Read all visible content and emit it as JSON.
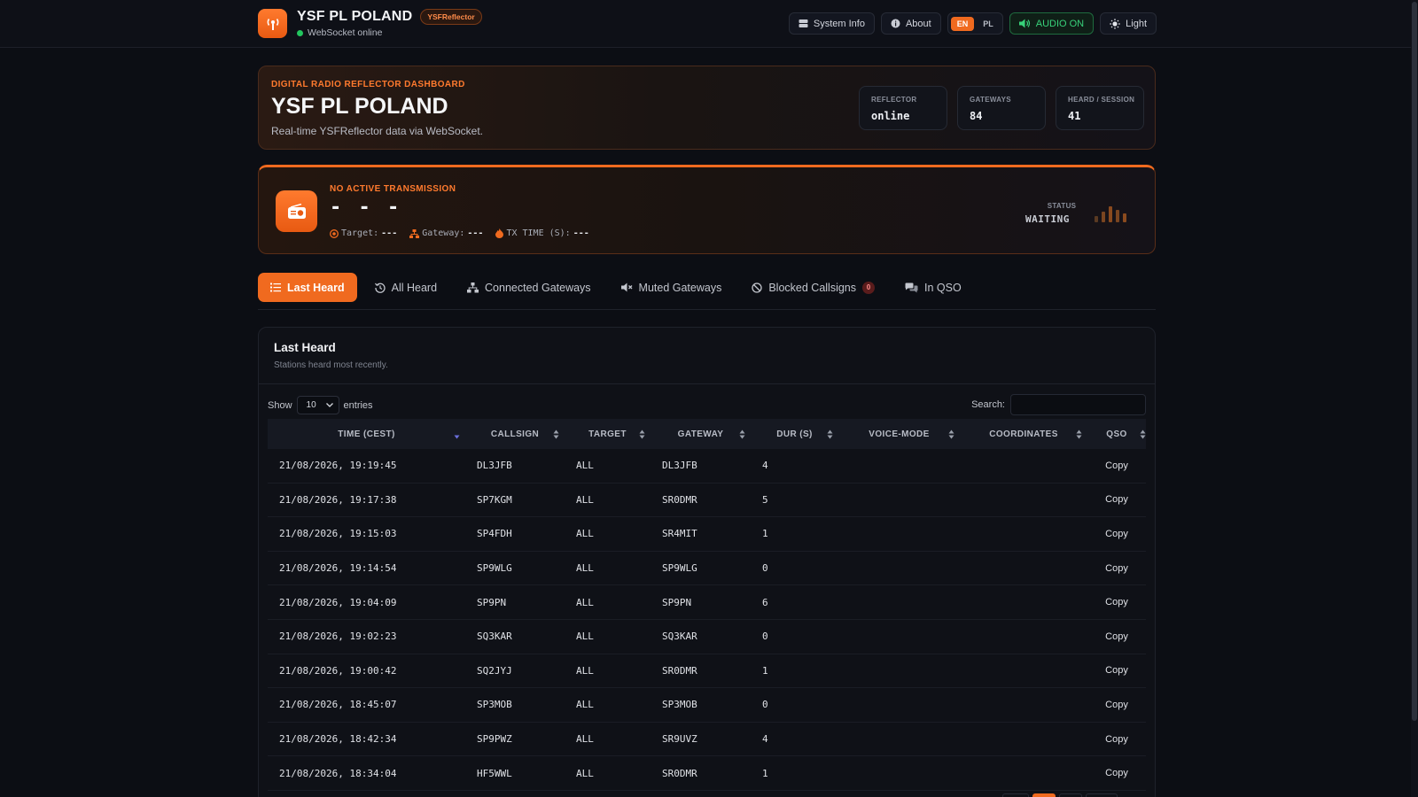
{
  "header": {
    "title": "YSF PL POLAND",
    "badge": "YSFReflector",
    "connection": "WebSocket online",
    "actions": {
      "system_info": "System Info",
      "about": "About",
      "lang_en": "EN",
      "lang_pl": "PL",
      "audio": "AUDIO ON",
      "theme": "Light"
    }
  },
  "hero": {
    "kicker": "DIGITAL RADIO REFLECTOR DASHBOARD",
    "title": "YSF PL POLAND",
    "subtitle": "Real-time YSFReflector data via WebSocket.",
    "stats": [
      {
        "label": "REFLECTOR",
        "value": "online"
      },
      {
        "label": "GATEWAYS",
        "value": "84"
      },
      {
        "label": "HEARD / SESSION",
        "value": "41"
      }
    ]
  },
  "transmission": {
    "kicker": "NO ACTIVE TRANSMISSION",
    "callsign": "- - -",
    "target_label": "Target:",
    "target_value": "---",
    "gateway_label": "Gateway:",
    "gateway_value": "---",
    "txtime_label": "TX TIME (S):",
    "txtime_value": "---",
    "status_label": "STATUS",
    "status_value": "WAITING"
  },
  "tabs": [
    {
      "label": "Last Heard",
      "icon": "list-icon",
      "active": true
    },
    {
      "label": "All Heard",
      "icon": "history-icon"
    },
    {
      "label": "Connected Gateways",
      "icon": "network-icon"
    },
    {
      "label": "Muted Gateways",
      "icon": "mute-icon"
    },
    {
      "label": "Blocked Callsigns",
      "icon": "ban-icon",
      "count": "0"
    },
    {
      "label": "In QSO",
      "icon": "chat-icon"
    }
  ],
  "table_card": {
    "title": "Last Heard",
    "subtitle": "Stations heard most recently.",
    "show_label": "Show",
    "entries_value": "10",
    "entries_label": "entries",
    "search_label": "Search:",
    "search_value": "",
    "columns": [
      "TIME (CEST)",
      "CALLSIGN",
      "TARGET",
      "GATEWAY",
      "DUR (S)",
      "VOICE-MODE",
      "COORDINATES",
      "QSO"
    ],
    "rows": [
      {
        "time": "21/08/2026, 19:19:45",
        "callsign": "DL3JFB",
        "target": "ALL",
        "gateway": "DL3JFB",
        "dur": "4",
        "mode": "",
        "coords": "",
        "qso": "Copy"
      },
      {
        "time": "21/08/2026, 19:17:38",
        "callsign": "SP7KGM",
        "target": "ALL",
        "gateway": "SR0DMR",
        "dur": "5",
        "mode": "",
        "coords": "",
        "qso": "Copy"
      },
      {
        "time": "21/08/2026, 19:15:03",
        "callsign": "SP4FDH",
        "target": "ALL",
        "gateway": "SR4MIT",
        "dur": "1",
        "mode": "",
        "coords": "",
        "qso": "Copy"
      },
      {
        "time": "21/08/2026, 19:14:54",
        "callsign": "SP9WLG",
        "target": "ALL",
        "gateway": "SP9WLG",
        "dur": "0",
        "mode": "",
        "coords": "",
        "qso": "Copy"
      },
      {
        "time": "21/08/2026, 19:04:09",
        "callsign": "SP9PN",
        "target": "ALL",
        "gateway": "SP9PN",
        "dur": "6",
        "mode": "",
        "coords": "",
        "qso": "Copy"
      },
      {
        "time": "21/08/2026, 19:02:23",
        "callsign": "SQ3KAR",
        "target": "ALL",
        "gateway": "SQ3KAR",
        "dur": "0",
        "mode": "",
        "coords": "",
        "qso": "Copy"
      },
      {
        "time": "21/08/2026, 19:00:42",
        "callsign": "SQ2JYJ",
        "target": "ALL",
        "gateway": "SR0DMR",
        "dur": "1",
        "mode": "",
        "coords": "",
        "qso": "Copy"
      },
      {
        "time": "21/08/2026, 18:45:07",
        "callsign": "SP3MOB",
        "target": "ALL",
        "gateway": "SP3MOB",
        "dur": "0",
        "mode": "",
        "coords": "",
        "qso": "Copy"
      },
      {
        "time": "21/08/2026, 18:42:34",
        "callsign": "SP9PWZ",
        "target": "ALL",
        "gateway": "SR9UVZ",
        "dur": "4",
        "mode": "",
        "coords": "",
        "qso": "Copy"
      },
      {
        "time": "21/08/2026, 18:34:04",
        "callsign": "HF5WWL",
        "target": "ALL",
        "gateway": "SR0DMR",
        "dur": "1",
        "mode": "",
        "coords": "",
        "qso": "Copy"
      }
    ]
  },
  "colors": {
    "accent": "#f06a1f",
    "background": "#0c0e14",
    "online": "#22c55e",
    "audio": "#38d27a"
  }
}
